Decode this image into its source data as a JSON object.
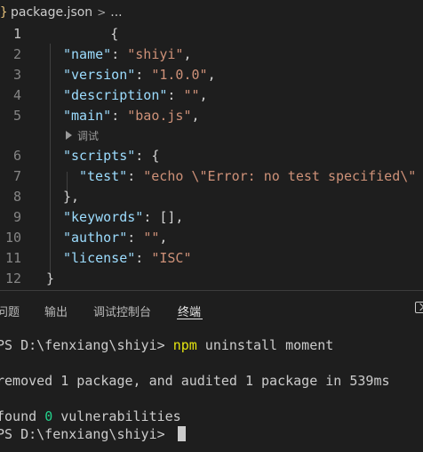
{
  "breadcrumb": {
    "file_icon": "braces-icon",
    "icon_glyph": "}",
    "file": "package.json",
    "separator": ">",
    "ellipsis": "..."
  },
  "editor": {
    "line_numbers": [
      "1",
      "2",
      "3",
      "4",
      "5",
      "6",
      "7",
      "8",
      "9",
      "10",
      "11",
      "12"
    ],
    "codelens": "调试",
    "code": {
      "l1": "{",
      "l2_key": "\"name\"",
      "l2_val": "\"shiyi\"",
      "l3_key": "\"version\"",
      "l3_val": "\"1.0.0\"",
      "l4_key": "\"description\"",
      "l4_val": "\"\"",
      "l5_key": "\"main\"",
      "l5_val": "\"bao.js\"",
      "l6_key": "\"scripts\"",
      "l6_open": "{",
      "l7_key": "\"test\"",
      "l7_val": "\"echo \\\"Error: no test specified\\\"",
      "l8": "},",
      "l9_key": "\"keywords\"",
      "l9_val": "[],",
      "l10_key": "\"author\"",
      "l10_val": "\"\"",
      "l11_key": "\"license\"",
      "l11_val": "\"ISC\"",
      "l12": "}",
      "colon": ": ",
      "comma": ","
    }
  },
  "panel": {
    "tabs": [
      "问题",
      "输出",
      "调试控制台",
      "终端"
    ],
    "active_tab": "终端",
    "maximize_icon": "maximize-panel-icon"
  },
  "terminal": {
    "prompt": "PS D:\\fenxiang\\shiyi> ",
    "cmd_npm": "npm",
    "cmd_rest": " uninstall moment",
    "line2": "removed 1 package, and audited 1 package in 539ms",
    "line3_pre": "found ",
    "line3_zero": "0",
    "line3_post": " vulnerabilities"
  },
  "colors": {
    "background": "#1e1e1e",
    "key": "#9cdcfe",
    "string": "#ce9178",
    "command": "#e5e510",
    "success": "#23d18b"
  }
}
